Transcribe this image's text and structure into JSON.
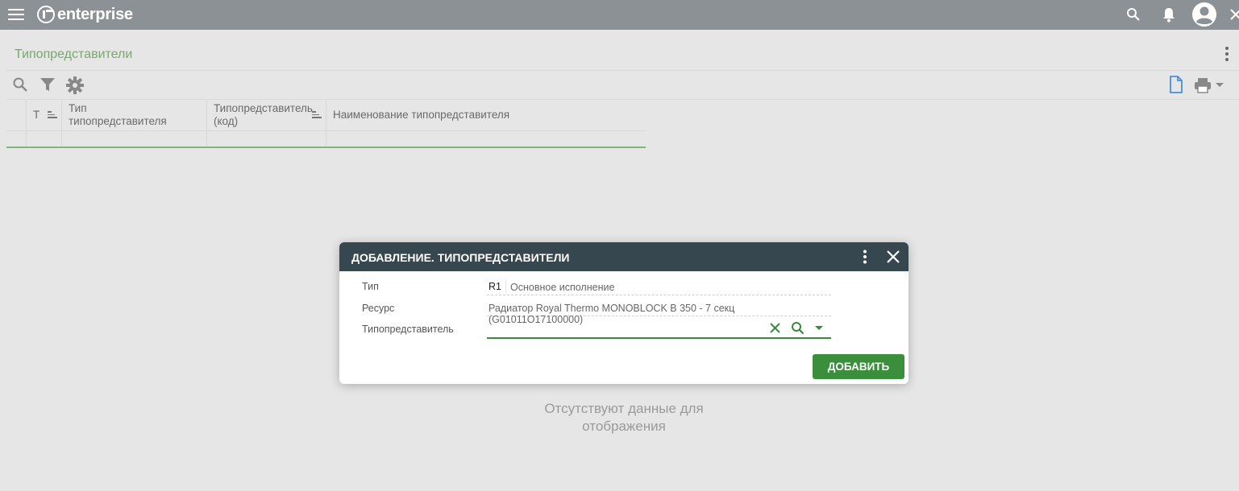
{
  "topbar": {
    "brand": "enterprise",
    "icons": [
      "menu-icon",
      "search-icon",
      "bell-icon",
      "account-icon",
      "close-icon"
    ]
  },
  "page": {
    "title": "Типопредставители",
    "toolbar_icons": [
      "search-icon",
      "filter-icon",
      "settings-icon",
      "document-icon",
      "print-icon"
    ]
  },
  "table": {
    "columns": [
      "Т",
      "Тип типопредставителя",
      "Типопредставитель (код)",
      "Наименование типопредставителя"
    ],
    "empty_text": "Отсутствуют данные для отображения"
  },
  "modal": {
    "title": "ДОБАВЛЕНИЕ. ТИПОПРЕДСТАВИТЕЛИ",
    "fields": [
      {
        "label": "Тип",
        "code": "R1",
        "value": "Основное исполнение"
      },
      {
        "label": "Ресурс",
        "value": "Радиатор Royal Thermo MONOBLOCK B 350  - 7 секц (G01011O17100000)"
      },
      {
        "label": "Типопредставитель",
        "value": ""
      }
    ],
    "add_button": "ДОБАВИТЬ"
  },
  "colors": {
    "topbar": "#8c9196",
    "title_green": "#78a86c",
    "modal_header": "#37474f",
    "button_green": "#3b8e3b"
  }
}
